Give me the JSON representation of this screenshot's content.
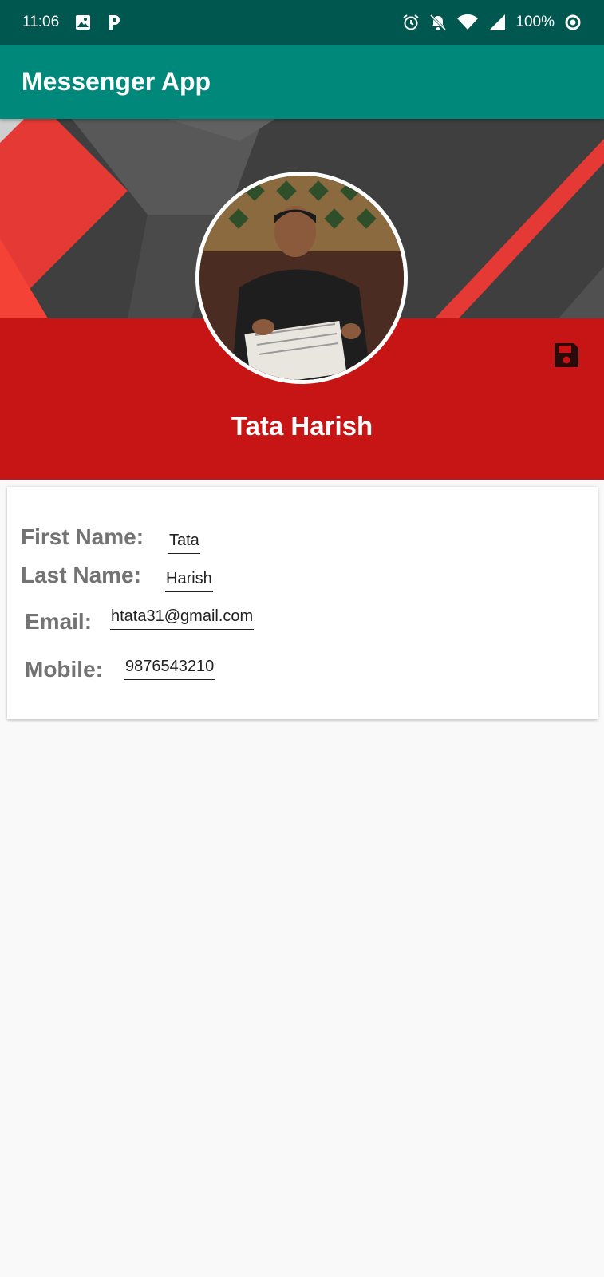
{
  "status_bar": {
    "time": "11:06",
    "battery": "100%",
    "icons": [
      "image-icon",
      "p-app-icon",
      "alarm-icon",
      "notifications-off-icon",
      "wifi-icon",
      "signal-icon",
      "data-saver-icon"
    ]
  },
  "app_bar": {
    "title": "Messenger App"
  },
  "profile": {
    "name": "Tata Harish",
    "avatar": "profile-photo",
    "save_icon": "save-icon"
  },
  "form": {
    "first_name": {
      "label": "First Name:",
      "value": "Tata"
    },
    "last_name": {
      "label": "Last Name:",
      "value": "Harish"
    },
    "email": {
      "label": "Email:",
      "value": "htata31@gmail.com"
    },
    "mobile": {
      "label": "Mobile:",
      "value": "9876543210"
    }
  },
  "colors": {
    "status_bar": "#00574f",
    "app_bar": "#00897b",
    "header_red": "#c71515",
    "label_gray": "#737373"
  }
}
